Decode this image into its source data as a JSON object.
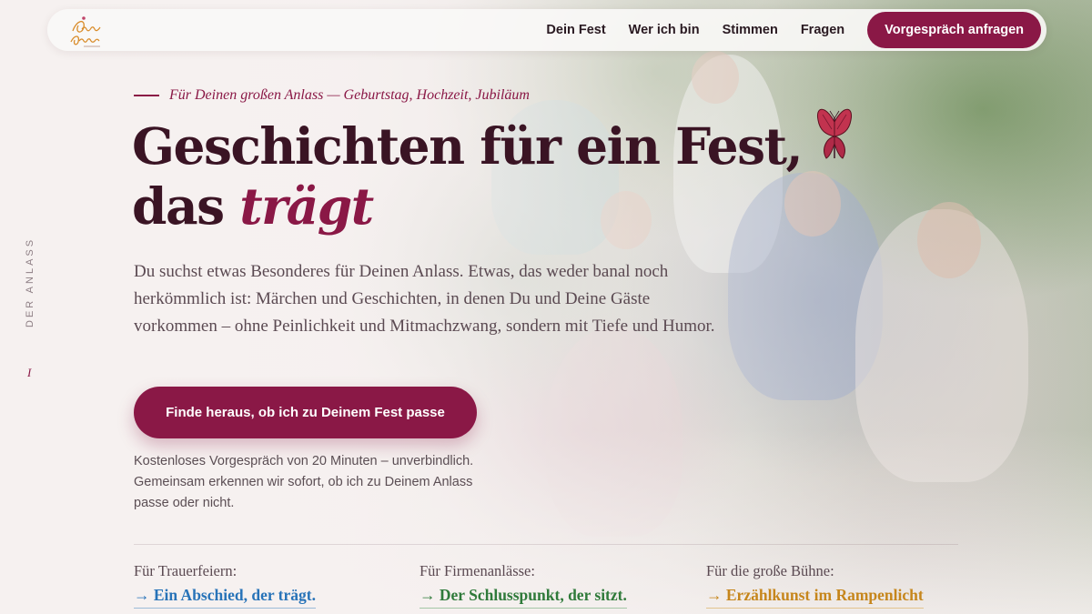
{
  "brand": {
    "logo_text": "Philipp Layer",
    "colors": {
      "accent": "#8a1846",
      "heading": "#3a1424",
      "blue": "#2873b8",
      "green": "#2f7a3a",
      "gold": "#c6861c"
    }
  },
  "nav": {
    "links": [
      {
        "label": "Dein Fest"
      },
      {
        "label": "Wer ich bin"
      },
      {
        "label": "Stimmen"
      },
      {
        "label": "Fragen"
      }
    ],
    "cta_label": "Vorgespräch anfragen"
  },
  "side": {
    "label": "DER ANLASS",
    "mark": "I"
  },
  "hero": {
    "eyebrow": "Für Deinen großen Anlass — Geburtstag, Hochzeit, Jubiläum",
    "headline_line1": "Geschichten für ein Fest,",
    "headline_line2_plain": "das ",
    "headline_line2_accent": "trägt",
    "lead": "Du suchst etwas Besonderes für Deinen Anlass. Etwas, das weder banal noch herkömmlich ist: Märchen und Geschichten, in denen Du und Deine Gäste vorkommen – ohne Peinlichkeit und Mitmachzwang, sondern mit Tiefe und Humor.",
    "cta_label": "Finde heraus, ob ich zu Deinem Fest passe",
    "cta_note": "Kostenloses Vorgespräch von 20 Minuten – unverbindlich. Gemeinsam erkennen wir sofort, ob ich zu Deinem Anlass passe oder nicht."
  },
  "crosslinks": [
    {
      "label": "Für Trauerfeiern:",
      "link": "→ Ein Abschied, der trägt."
    },
    {
      "label": "Für Firmenanlässe:",
      "link": "→ Der Schlusspunkt, der sitzt."
    },
    {
      "label": "Für die große Bühne:",
      "link": "→ Erzählkunst im Rampenlicht"
    }
  ],
  "icons": {
    "logo": "signature-logo-icon",
    "decor": "butterfly-icon"
  }
}
